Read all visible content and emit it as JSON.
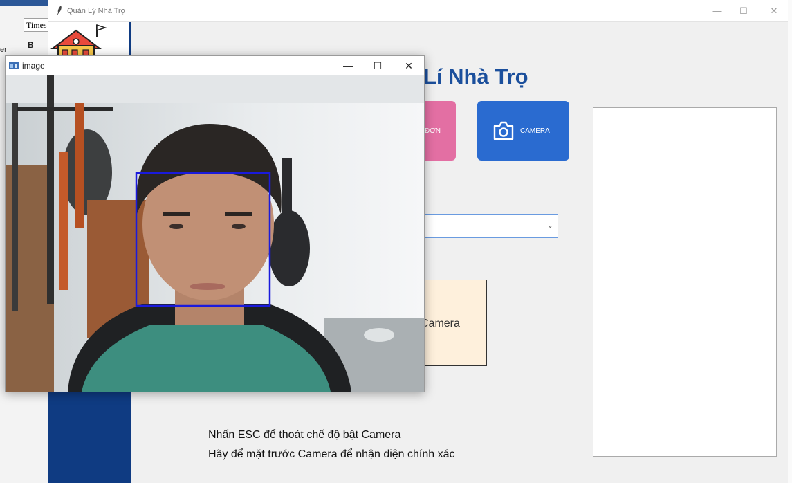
{
  "background_editor": {
    "font_name": "Times",
    "bold_label": "B",
    "cut_text": "er"
  },
  "app_window": {
    "title": "Quản Lý Nhà Trọ",
    "controls": {
      "minimize": "—",
      "maximize": "☐",
      "close": "✕"
    }
  },
  "main": {
    "heading": "Lí Nhà Trọ",
    "pink_button_label": "ĐƠN",
    "camera_button_label": "CAMERA",
    "combo_value": "",
    "camera_card_label": "Camera",
    "hints": [
      "Nhấn ESC để thoát chế độ bật Camera",
      "Hãy để mặt trước Camera để nhận diện chính xác"
    ]
  },
  "image_window": {
    "title": "image",
    "controls": {
      "minimize": "—",
      "maximize": "☐",
      "close": "✕"
    }
  },
  "colors": {
    "sidebar": "#0f3b82",
    "heading": "#1b4f9c",
    "pink_button": "#e36fa3",
    "camera_button": "#2a6bd0",
    "camera_card": "#fef0dc",
    "face_box": "#1a1adc"
  }
}
